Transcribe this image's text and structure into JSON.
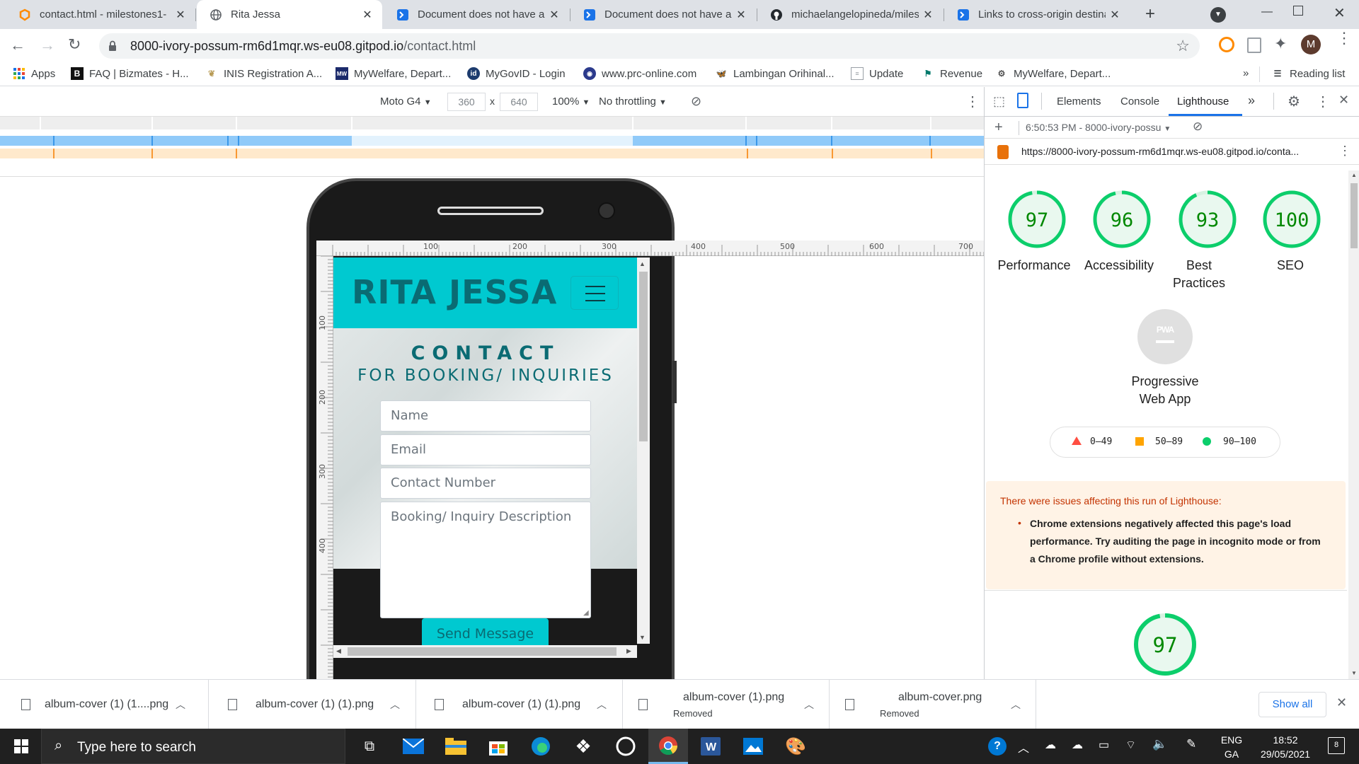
{
  "tabs": [
    {
      "title": "contact.html - milestones1-",
      "favicon": "gitpod-icon",
      "active": false
    },
    {
      "title": "Rita Jessa",
      "favicon": "globe-icon",
      "active": true
    },
    {
      "title": "Document does not have a",
      "favicon": "lighthouse-prompt-icon",
      "active": false
    },
    {
      "title": "Document does not have a",
      "favicon": "lighthouse-prompt-icon",
      "active": false
    },
    {
      "title": "michaelangelopineda/miles",
      "favicon": "github-icon",
      "active": false
    },
    {
      "title": "Links to cross-origin destina",
      "favicon": "lighthouse-prompt-icon",
      "active": false
    }
  ],
  "url": {
    "host": "8000-ivory-possum-rm6d1mqr.ws-eu08.gitpod.io",
    "path": "/contact.html"
  },
  "profile_initial": "M",
  "bookmarks": [
    {
      "label": "Apps",
      "icon": "apps-grid-icon"
    },
    {
      "label": "FAQ | Bizmates - H...",
      "icon": "bizmates-icon"
    },
    {
      "label": "INIS Registration A...",
      "icon": "inis-icon"
    },
    {
      "label": "MyWelfare, Depart...",
      "icon": "mywelfare-icon"
    },
    {
      "label": "MyGovID - Login",
      "icon": "mygovid-icon"
    },
    {
      "label": "www.prc-online.com",
      "icon": "prc-icon"
    },
    {
      "label": "Lambingan Orihinal...",
      "icon": "bird-icon"
    },
    {
      "label": "Update",
      "icon": "doc-icon"
    },
    {
      "label": "Revenue",
      "icon": "revenue-icon"
    },
    {
      "label": "MyWelfare, Depart...",
      "icon": "mywelfare-icon"
    }
  ],
  "reading_list": "Reading list",
  "device": {
    "name": "Moto G4",
    "width": "360",
    "height": "640",
    "times": "x",
    "zoom": "100%",
    "throttle": "No throttling"
  },
  "ruler_ticks": [
    "100",
    "200",
    "300",
    "400",
    "500",
    "600",
    "700"
  ],
  "vruler_ticks": [
    "100",
    "200",
    "300",
    "400"
  ],
  "devtools": {
    "tabs": [
      "Elements",
      "Console",
      "Lighthouse"
    ],
    "active_tab": "Lighthouse",
    "run_time": "6:50:53 PM - 8000-ivory-possu",
    "report_url": "https://8000-ivory-possum-rm6d1mqr.ws-eu08.gitpod.io/conta...",
    "scores": [
      {
        "value": 97,
        "label": "Performance"
      },
      {
        "value": 96,
        "label": "Accessibility"
      },
      {
        "value": 93,
        "label": "Best Practices"
      },
      {
        "value": 100,
        "label": "SEO"
      }
    ],
    "pwa": {
      "icon_text": "PWA",
      "label": "Progressive Web App"
    },
    "legend": [
      {
        "range": "0–49",
        "color": "#ff4e42"
      },
      {
        "range": "50–89",
        "color": "#ffa400"
      },
      {
        "range": "90–100",
        "color": "#0cce6b"
      }
    ],
    "warning_title": "There were issues affecting this run of Lighthouse:",
    "warning_item": "Chrome extensions negatively affected this page's load performance. Try auditing the page in incognito mode or from a Chrome profile without extensions.",
    "bottom_score": 97,
    "score_green": "#0cce6b",
    "score_text_green": "#008800"
  },
  "site": {
    "brand": "RITA JESSA",
    "heading": "CONTACT",
    "subheading": "FOR BOOKING/ INQUIRIES",
    "fields": [
      "Name",
      "Email",
      "Contact Number",
      "Booking/ Inquiry Description"
    ],
    "button": "Send Message",
    "accent": "#00c9d0",
    "text_color": "#0a6b73"
  },
  "downloads": [
    {
      "name": "album-cover (1) (1....png",
      "status": ""
    },
    {
      "name": "album-cover (1) (1).png",
      "status": ""
    },
    {
      "name": "album-cover (1) (1).png",
      "status": ""
    },
    {
      "name": "album-cover (1).png",
      "status": "Removed"
    },
    {
      "name": "album-cover.png",
      "status": "Removed"
    }
  ],
  "show_all": "Show all",
  "taskbar": {
    "search_placeholder": "Type here to search",
    "lang1": "ENG",
    "lang2": "GA",
    "time": "18:52",
    "date": "29/05/2021",
    "notif_count": "8"
  }
}
